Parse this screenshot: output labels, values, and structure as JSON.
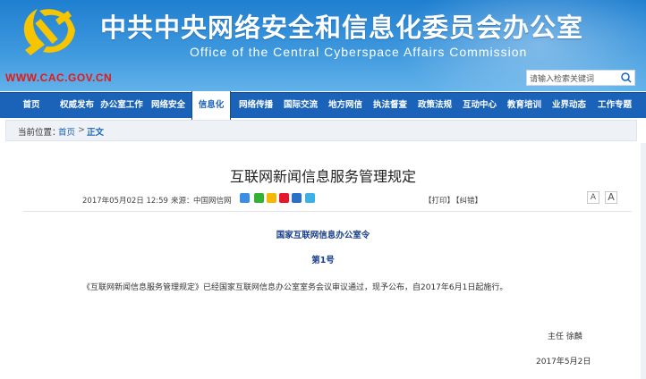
{
  "header": {
    "title_cn": "中共中央网络安全和信息化委员会办公室",
    "title_en": "Office of the Central Cyberspace Affairs Commission",
    "site_url": "WWW.CAC.GOV.CN",
    "search_placeholder": "请输入检索关键词"
  },
  "nav": {
    "items": [
      {
        "label": "首页"
      },
      {
        "label": "权威发布"
      },
      {
        "label": "办公室工作"
      },
      {
        "label": "网络安全"
      },
      {
        "label": "信息化",
        "active": true
      },
      {
        "label": "网络传播"
      },
      {
        "label": "国际交流"
      },
      {
        "label": "地方网信"
      },
      {
        "label": "执法督查"
      },
      {
        "label": "政策法规"
      },
      {
        "label": "互动中心"
      },
      {
        "label": "教育培训"
      },
      {
        "label": "业界动态"
      },
      {
        "label": "工作专题"
      }
    ]
  },
  "breadcrumb": {
    "prefix": "当前位置：",
    "home": "首页",
    "separator": ">",
    "current": "正文"
  },
  "article": {
    "title": "互联网新闻信息服务管理规定",
    "date": "2017年05月02日 12:59",
    "source_label": "来源：",
    "source": "中国网信网",
    "print_label": "【打印】",
    "correct_label": "【纠错】",
    "font_small": "A",
    "font_large": "A",
    "decree_title": "国家互联网信息办公室令",
    "decree_number": "第1号",
    "body": "《互联网新闻信息服务管理规定》已经国家互联网信息办公室室务会议审议通过，现予公布，自2017年6月1日起施行。",
    "signer": "主任  徐麟",
    "sign_date": "2017年5月2日"
  },
  "colors": {
    "banner_top": "#1f7fd0",
    "nav_bg": "#1a63b8",
    "url_red": "#e8170f",
    "emblem_gold": "#f7c500"
  },
  "icons": {
    "emblem": "party-emblem-icon",
    "search": "search-icon",
    "share": [
      "share-plus-icon",
      "wechat-icon",
      "qzone-icon",
      "weibo-icon",
      "renren-icon",
      "tencent-weibo-icon"
    ]
  }
}
